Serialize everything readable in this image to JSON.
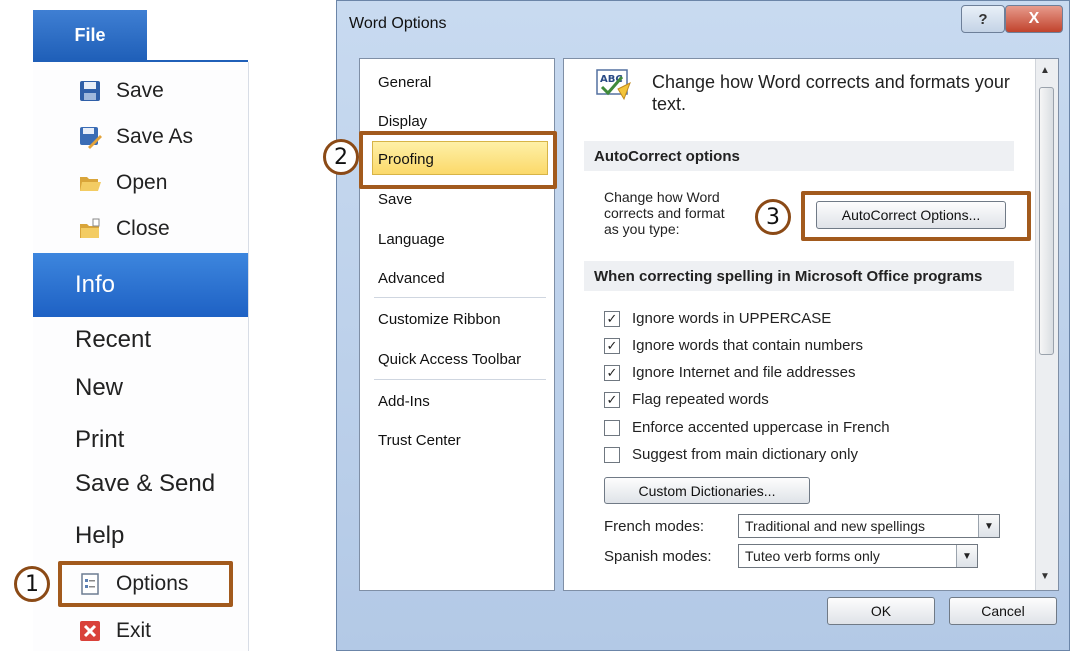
{
  "backstage": {
    "file_tab": "File",
    "save": "Save",
    "save_as": "Save As",
    "open": "Open",
    "close": "Close",
    "info": "Info",
    "recent": "Recent",
    "new": "New",
    "print": "Print",
    "save_send": "Save & Send",
    "help": "Help",
    "options": "Options",
    "exit": "Exit"
  },
  "steps": {
    "one": "1",
    "two": "2",
    "three": "3"
  },
  "dialog": {
    "title": "Word Options",
    "help_btn": "?",
    "close_btn": "X",
    "nav": {
      "general": "General",
      "display": "Display",
      "proofing": "Proofing",
      "save": "Save",
      "language": "Language",
      "advanced": "Advanced",
      "customize_ribbon": "Customize Ribbon",
      "quick_access": "Quick Access Toolbar",
      "add_ins": "Add-Ins",
      "trust_center": "Trust Center"
    },
    "header": "Change how Word corrects and formats your text.",
    "autocorrect_heading": "AutoCorrect options",
    "autocorrect_desc_1": "Change how Word",
    "autocorrect_desc_2": "corrects and format",
    "autocorrect_desc_3": "as you type:",
    "autocorrect_button": "AutoCorrect Options...",
    "spelling_heading": "When correcting spelling in Microsoft Office programs",
    "checkboxes": [
      {
        "label": "Ignore words in UPPERCASE",
        "checked": true
      },
      {
        "label": "Ignore words that contain numbers",
        "checked": true
      },
      {
        "label": "Ignore Internet and file addresses",
        "checked": true
      },
      {
        "label": "Flag repeated words",
        "checked": true
      },
      {
        "label": "Enforce accented uppercase in French",
        "checked": false
      },
      {
        "label": "Suggest from main dictionary only",
        "checked": false
      }
    ],
    "custom_dict_button": "Custom Dictionaries...",
    "french_label": "French modes:",
    "french_value": "Traditional and new spellings",
    "spanish_label": "Spanish modes:",
    "spanish_value": "Tuteo verb forms only",
    "ok": "OK",
    "cancel": "Cancel"
  }
}
